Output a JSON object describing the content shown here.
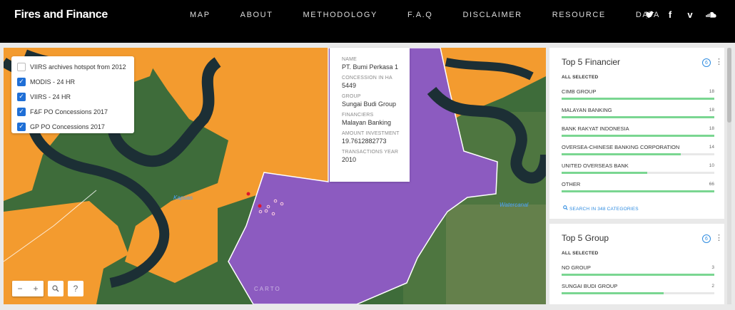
{
  "header": {
    "brand": "Fires and Finance",
    "nav": [
      "MAP",
      "ABOUT",
      "METHODOLOGY",
      "F.A.Q",
      "DISCLAIMER",
      "RESOURCE",
      "DATA"
    ],
    "social_icons": [
      "twitter-icon",
      "facebook-icon",
      "vimeo-icon",
      "soundcloud-icon"
    ]
  },
  "layers": [
    {
      "label": "VIIRS archives hotspot from 2012",
      "checked": false
    },
    {
      "label": "MODIS - 24 HR",
      "checked": true
    },
    {
      "label": "VIIRS - 24 HR",
      "checked": true
    },
    {
      "label": "F&F PO Concessions 2017",
      "checked": true
    },
    {
      "label": "GP PO Concessions 2017",
      "checked": true
    }
  ],
  "popup": {
    "name_label": "NAME",
    "name": "PT. Bumi Perkasa 1",
    "concession_label": "CONCESSION IN HA",
    "concession": "5449",
    "group_label": "GROUP",
    "group": "Sungai Budi Group",
    "financiers_label": "FINANCIERS",
    "financiers": "Malayan Banking",
    "investment_label": "AMOUNT INVESTMENT",
    "investment": "19.7612882773",
    "year_label": "TRANSACTIONS YEAR",
    "year": "2010"
  },
  "map": {
    "labels": {
      "river": "Kapuas",
      "canal": "Watercanal"
    },
    "attribution": "CARTO",
    "controls": {
      "zoom_out": "−",
      "zoom_in": "+",
      "search": "⚲",
      "help": "?"
    }
  },
  "colors": {
    "concession_orange": "#f39b2f",
    "concession_purple": "#8c5bc0",
    "accent": "#2d8be0",
    "bar": "#7ad691"
  },
  "financier_widget": {
    "title": "Top 5 Financier",
    "count": "6",
    "selected": "ALL SELECTED",
    "rows": [
      {
        "name": "CIMB GROUP",
        "value": "18",
        "fraction": 1.0
      },
      {
        "name": "MALAYAN BANKING",
        "value": "18",
        "fraction": 1.0
      },
      {
        "name": "BANK RAKYAT INDONESIA",
        "value": "18",
        "fraction": 1.0
      },
      {
        "name": "OVERSEA-CHINESE BANKING CORPORATION",
        "value": "14",
        "fraction": 0.78
      },
      {
        "name": "UNITED OVERSEAS BANK",
        "value": "10",
        "fraction": 0.56
      },
      {
        "name": "OTHER",
        "value": "66",
        "fraction": 1.0
      }
    ],
    "search_link": "SEARCH IN 348 CATEGORIES"
  },
  "group_widget": {
    "title": "Top 5 Group",
    "count": "6",
    "selected": "ALL SELECTED",
    "rows": [
      {
        "name": "NO GROUP",
        "value": "3",
        "fraction": 1.0
      },
      {
        "name": "SUNGAI BUDI GROUP",
        "value": "2",
        "fraction": 0.67
      }
    ]
  }
}
